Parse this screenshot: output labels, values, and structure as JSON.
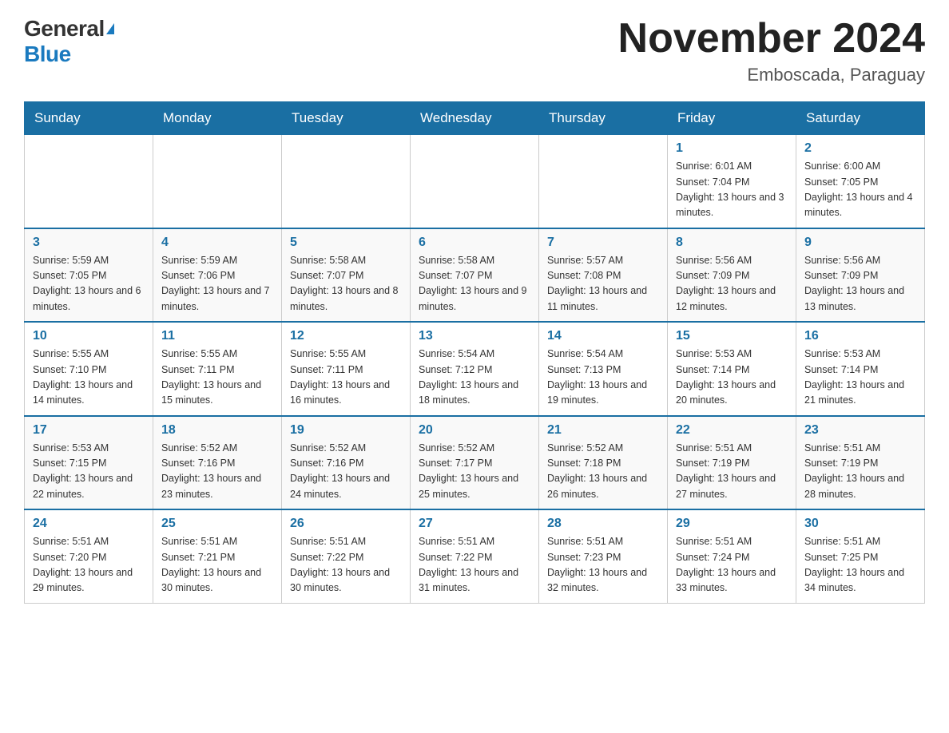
{
  "header": {
    "logo_general": "General",
    "logo_blue": "Blue",
    "month_title": "November 2024",
    "location": "Emboscada, Paraguay"
  },
  "weekdays": [
    "Sunday",
    "Monday",
    "Tuesday",
    "Wednesday",
    "Thursday",
    "Friday",
    "Saturday"
  ],
  "rows": [
    [
      {
        "day": "",
        "sunrise": "",
        "sunset": "",
        "daylight": ""
      },
      {
        "day": "",
        "sunrise": "",
        "sunset": "",
        "daylight": ""
      },
      {
        "day": "",
        "sunrise": "",
        "sunset": "",
        "daylight": ""
      },
      {
        "day": "",
        "sunrise": "",
        "sunset": "",
        "daylight": ""
      },
      {
        "day": "",
        "sunrise": "",
        "sunset": "",
        "daylight": ""
      },
      {
        "day": "1",
        "sunrise": "Sunrise: 6:01 AM",
        "sunset": "Sunset: 7:04 PM",
        "daylight": "Daylight: 13 hours and 3 minutes."
      },
      {
        "day": "2",
        "sunrise": "Sunrise: 6:00 AM",
        "sunset": "Sunset: 7:05 PM",
        "daylight": "Daylight: 13 hours and 4 minutes."
      }
    ],
    [
      {
        "day": "3",
        "sunrise": "Sunrise: 5:59 AM",
        "sunset": "Sunset: 7:05 PM",
        "daylight": "Daylight: 13 hours and 6 minutes."
      },
      {
        "day": "4",
        "sunrise": "Sunrise: 5:59 AM",
        "sunset": "Sunset: 7:06 PM",
        "daylight": "Daylight: 13 hours and 7 minutes."
      },
      {
        "day": "5",
        "sunrise": "Sunrise: 5:58 AM",
        "sunset": "Sunset: 7:07 PM",
        "daylight": "Daylight: 13 hours and 8 minutes."
      },
      {
        "day": "6",
        "sunrise": "Sunrise: 5:58 AM",
        "sunset": "Sunset: 7:07 PM",
        "daylight": "Daylight: 13 hours and 9 minutes."
      },
      {
        "day": "7",
        "sunrise": "Sunrise: 5:57 AM",
        "sunset": "Sunset: 7:08 PM",
        "daylight": "Daylight: 13 hours and 11 minutes."
      },
      {
        "day": "8",
        "sunrise": "Sunrise: 5:56 AM",
        "sunset": "Sunset: 7:09 PM",
        "daylight": "Daylight: 13 hours and 12 minutes."
      },
      {
        "day": "9",
        "sunrise": "Sunrise: 5:56 AM",
        "sunset": "Sunset: 7:09 PM",
        "daylight": "Daylight: 13 hours and 13 minutes."
      }
    ],
    [
      {
        "day": "10",
        "sunrise": "Sunrise: 5:55 AM",
        "sunset": "Sunset: 7:10 PM",
        "daylight": "Daylight: 13 hours and 14 minutes."
      },
      {
        "day": "11",
        "sunrise": "Sunrise: 5:55 AM",
        "sunset": "Sunset: 7:11 PM",
        "daylight": "Daylight: 13 hours and 15 minutes."
      },
      {
        "day": "12",
        "sunrise": "Sunrise: 5:55 AM",
        "sunset": "Sunset: 7:11 PM",
        "daylight": "Daylight: 13 hours and 16 minutes."
      },
      {
        "day": "13",
        "sunrise": "Sunrise: 5:54 AM",
        "sunset": "Sunset: 7:12 PM",
        "daylight": "Daylight: 13 hours and 18 minutes."
      },
      {
        "day": "14",
        "sunrise": "Sunrise: 5:54 AM",
        "sunset": "Sunset: 7:13 PM",
        "daylight": "Daylight: 13 hours and 19 minutes."
      },
      {
        "day": "15",
        "sunrise": "Sunrise: 5:53 AM",
        "sunset": "Sunset: 7:14 PM",
        "daylight": "Daylight: 13 hours and 20 minutes."
      },
      {
        "day": "16",
        "sunrise": "Sunrise: 5:53 AM",
        "sunset": "Sunset: 7:14 PM",
        "daylight": "Daylight: 13 hours and 21 minutes."
      }
    ],
    [
      {
        "day": "17",
        "sunrise": "Sunrise: 5:53 AM",
        "sunset": "Sunset: 7:15 PM",
        "daylight": "Daylight: 13 hours and 22 minutes."
      },
      {
        "day": "18",
        "sunrise": "Sunrise: 5:52 AM",
        "sunset": "Sunset: 7:16 PM",
        "daylight": "Daylight: 13 hours and 23 minutes."
      },
      {
        "day": "19",
        "sunrise": "Sunrise: 5:52 AM",
        "sunset": "Sunset: 7:16 PM",
        "daylight": "Daylight: 13 hours and 24 minutes."
      },
      {
        "day": "20",
        "sunrise": "Sunrise: 5:52 AM",
        "sunset": "Sunset: 7:17 PM",
        "daylight": "Daylight: 13 hours and 25 minutes."
      },
      {
        "day": "21",
        "sunrise": "Sunrise: 5:52 AM",
        "sunset": "Sunset: 7:18 PM",
        "daylight": "Daylight: 13 hours and 26 minutes."
      },
      {
        "day": "22",
        "sunrise": "Sunrise: 5:51 AM",
        "sunset": "Sunset: 7:19 PM",
        "daylight": "Daylight: 13 hours and 27 minutes."
      },
      {
        "day": "23",
        "sunrise": "Sunrise: 5:51 AM",
        "sunset": "Sunset: 7:19 PM",
        "daylight": "Daylight: 13 hours and 28 minutes."
      }
    ],
    [
      {
        "day": "24",
        "sunrise": "Sunrise: 5:51 AM",
        "sunset": "Sunset: 7:20 PM",
        "daylight": "Daylight: 13 hours and 29 minutes."
      },
      {
        "day": "25",
        "sunrise": "Sunrise: 5:51 AM",
        "sunset": "Sunset: 7:21 PM",
        "daylight": "Daylight: 13 hours and 30 minutes."
      },
      {
        "day": "26",
        "sunrise": "Sunrise: 5:51 AM",
        "sunset": "Sunset: 7:22 PM",
        "daylight": "Daylight: 13 hours and 30 minutes."
      },
      {
        "day": "27",
        "sunrise": "Sunrise: 5:51 AM",
        "sunset": "Sunset: 7:22 PM",
        "daylight": "Daylight: 13 hours and 31 minutes."
      },
      {
        "day": "28",
        "sunrise": "Sunrise: 5:51 AM",
        "sunset": "Sunset: 7:23 PM",
        "daylight": "Daylight: 13 hours and 32 minutes."
      },
      {
        "day": "29",
        "sunrise": "Sunrise: 5:51 AM",
        "sunset": "Sunset: 7:24 PM",
        "daylight": "Daylight: 13 hours and 33 minutes."
      },
      {
        "day": "30",
        "sunrise": "Sunrise: 5:51 AM",
        "sunset": "Sunset: 7:25 PM",
        "daylight": "Daylight: 13 hours and 34 minutes."
      }
    ]
  ]
}
